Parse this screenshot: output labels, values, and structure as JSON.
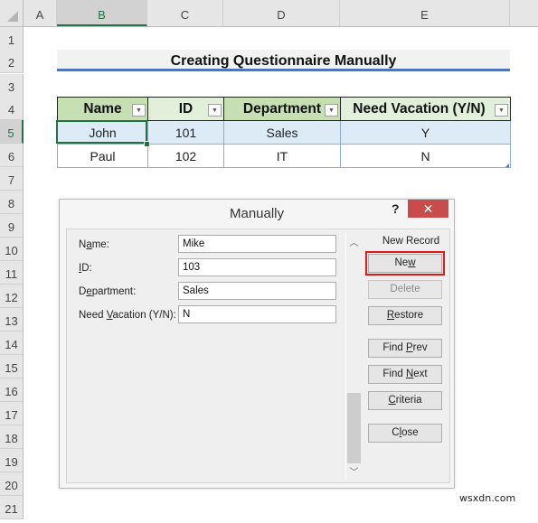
{
  "sheet": {
    "columns": [
      "A",
      "B",
      "C",
      "D",
      "E"
    ],
    "selected_column": "B",
    "rows": [
      "1",
      "2",
      "3",
      "4",
      "5",
      "6",
      "7",
      "8",
      "9",
      "10",
      "11",
      "12",
      "13",
      "14",
      "15",
      "16",
      "17",
      "18",
      "19",
      "20",
      "21"
    ],
    "selected_row": "5",
    "title": "Creating Questionnaire Manually",
    "table": {
      "headers": [
        "Name",
        "ID",
        "Department",
        "Need Vacation (Y/N)"
      ],
      "rows": [
        [
          "John",
          "101",
          "Sales",
          "Y"
        ],
        [
          "Paul",
          "102",
          "IT",
          "N"
        ]
      ]
    },
    "active_cell": "B5"
  },
  "dialog": {
    "title": "Manually",
    "help_label": "?",
    "close_icon": "close-x",
    "record_status": "New Record",
    "fields": [
      {
        "label_pre": "N",
        "label_u": "a",
        "label_post": "me:",
        "value": "Mike"
      },
      {
        "label_pre": "",
        "label_u": "I",
        "label_post": "D:",
        "value": "103"
      },
      {
        "label_pre": "D",
        "label_u": "e",
        "label_post": "partment:",
        "value": "Sales"
      },
      {
        "label_pre": "Need ",
        "label_u": "V",
        "label_post": "acation (Y/N):",
        "value": "N"
      }
    ],
    "buttons": [
      {
        "pre": "Ne",
        "u": "w",
        "post": "",
        "state": "highlighted"
      },
      {
        "pre": "",
        "u": "D",
        "post": "elete",
        "state": "disabled"
      },
      {
        "pre": "",
        "u": "R",
        "post": "estore",
        "state": "enabled"
      },
      {
        "pre": "Find ",
        "u": "P",
        "post": "rev",
        "state": "enabled"
      },
      {
        "pre": "Find ",
        "u": "N",
        "post": "ext",
        "state": "enabled"
      },
      {
        "pre": "",
        "u": "C",
        "post": "riteria",
        "state": "enabled"
      },
      {
        "pre": "C",
        "u": "l",
        "post": "ose",
        "state": "enabled"
      }
    ],
    "scroll_position": "bottom"
  },
  "colors": {
    "excel_green": "#217346",
    "title_underline": "#4f76b8",
    "header_green_dark": "#c6e0b4",
    "header_green_light": "#e2efda",
    "row_band": "#ddebf7",
    "highlight_red": "#e01a1a",
    "close_red": "#c94c4c"
  },
  "watermark": "wsxdn.com"
}
